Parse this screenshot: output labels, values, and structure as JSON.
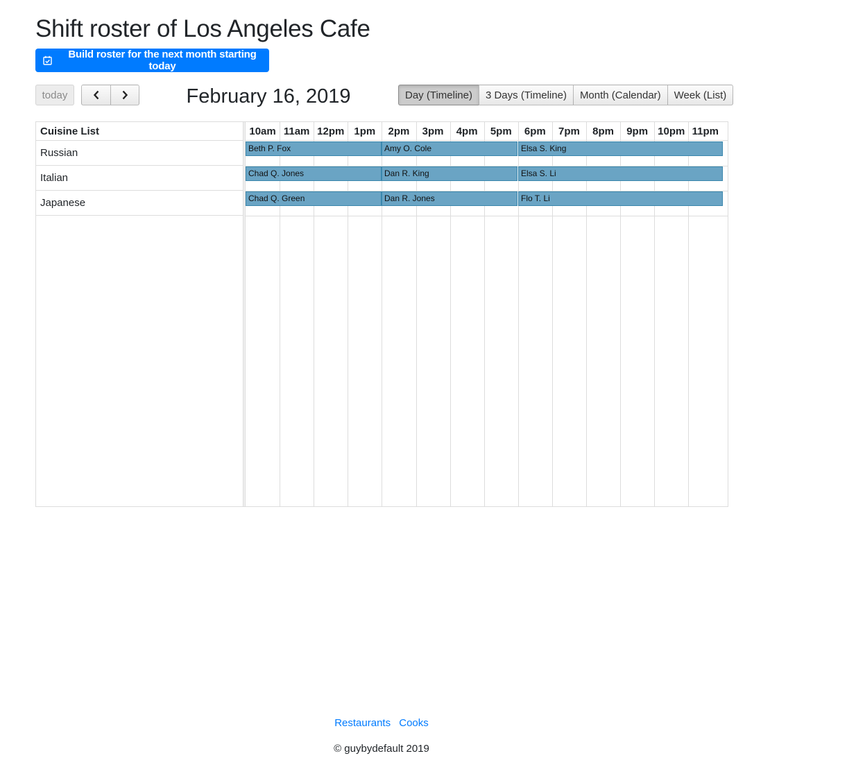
{
  "page": {
    "title": "Shift roster of Los Angeles Cafe",
    "build_button_label": "Build roster for the next month starting today"
  },
  "toolbar": {
    "today_label": "today",
    "date_title": "February 16, 2019",
    "views": [
      {
        "label": "Day (Timeline)",
        "active": true
      },
      {
        "label": "3 Days (Timeline)",
        "active": false
      },
      {
        "label": "Month (Calendar)",
        "active": false
      },
      {
        "label": "Week (List)",
        "active": false
      }
    ]
  },
  "scheduler": {
    "resource_header": "Cuisine List",
    "hours": [
      "10am",
      "11am",
      "12pm",
      "1pm",
      "2pm",
      "3pm",
      "4pm",
      "5pm",
      "6pm",
      "7pm",
      "8pm",
      "9pm",
      "10pm",
      "11pm"
    ],
    "resources": [
      {
        "name": "Russian",
        "shifts": [
          {
            "name": "Beth P. Fox",
            "start": "10am",
            "end": "2pm"
          },
          {
            "name": "Amy O. Cole",
            "start": "2pm",
            "end": "6pm"
          },
          {
            "name": "Elsa S. King",
            "start": "6pm",
            "end": "12am"
          }
        ]
      },
      {
        "name": "Italian",
        "shifts": [
          {
            "name": "Chad Q. Jones",
            "start": "10am",
            "end": "2pm"
          },
          {
            "name": "Dan R. King",
            "start": "2pm",
            "end": "6pm"
          },
          {
            "name": "Elsa S. Li",
            "start": "6pm",
            "end": "12am"
          }
        ]
      },
      {
        "name": "Japanese",
        "shifts": [
          {
            "name": "Chad Q. Green",
            "start": "10am",
            "end": "2pm"
          },
          {
            "name": "Dan R. Jones",
            "start": "2pm",
            "end": "6pm"
          },
          {
            "name": "Flo T. Li",
            "start": "6pm",
            "end": "12am"
          }
        ]
      }
    ]
  },
  "footer": {
    "links": [
      "Restaurants",
      "Cooks"
    ],
    "copyright": "© guybydefault 2019"
  },
  "colors": {
    "primary": "#007bff",
    "event_fill": "#6aa4c4",
    "event_border": "#3a87ad",
    "grid_line": "#dddddd"
  },
  "icons": {
    "build_button": "calendar-check-icon",
    "prev": "chevron-left-icon",
    "next": "chevron-right-icon"
  }
}
